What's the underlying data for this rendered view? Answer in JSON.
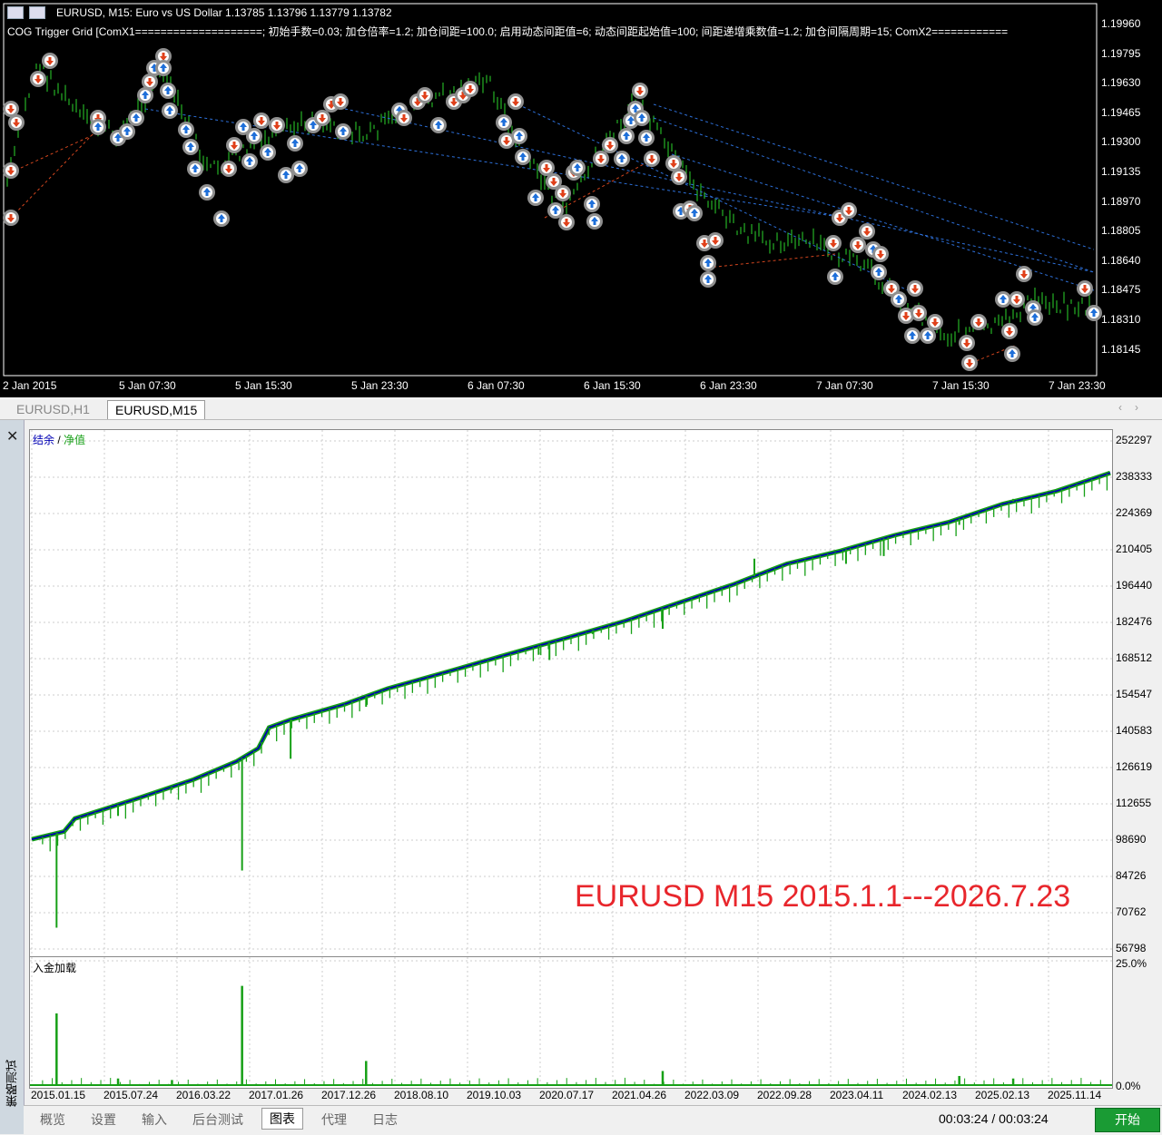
{
  "price_chart": {
    "title": "EURUSD, M15:  Euro vs US Dollar  1.13785 1.13796 1.13779 1.13782",
    "ea_line": "COG Trigger Grid [ComX1====================; 初始手数=0.03; 加仓倍率=1.2; 加仓间距=100.0; 启用动态间距值=6; 动态间距起始值=100; 间距递增乘数值=1.2; 加仓间隔周期=15; ComX2============",
    "y_labels": [
      "1.19960",
      "1.19795",
      "1.19630",
      "1.19465",
      "1.19300",
      "1.19135",
      "1.18970",
      "1.18805",
      "1.18640",
      "1.18475",
      "1.18310",
      "1.18145"
    ],
    "x_labels": [
      "2 Jan 2015",
      "5 Jan 07:30",
      "5 Jan 15:30",
      "5 Jan 23:30",
      "6 Jan 07:30",
      "6 Jan 15:30",
      "6 Jan 23:30",
      "7 Jan 07:30",
      "7 Jan 15:30",
      "7 Jan 23:30"
    ],
    "colors": {
      "background": "#000000",
      "candles": "#2bd62b",
      "buy_arrow": "#1e6fd9",
      "sell_arrow": "#e0401a",
      "marker_ring": "#8f8f8f"
    }
  },
  "chart_tabs": [
    {
      "label": "EURUSD,H1",
      "active": false
    },
    {
      "label": "EURUSD,M15",
      "active": true
    }
  ],
  "tester": {
    "side_label": "策略测试",
    "legend_balance": "结余",
    "legend_sep": " / ",
    "legend_equity": "净值",
    "deposit_title": "入金加载",
    "annotation": "EURUSD M15 2015.1.1---2026.7.23",
    "timer": "00:03:24 / 00:03:24",
    "start_label": "开始",
    "tabs": [
      {
        "label": "概览",
        "active": false
      },
      {
        "label": "设置",
        "active": false
      },
      {
        "label": "输入",
        "active": false
      },
      {
        "label": "后台测试",
        "active": false
      },
      {
        "label": "图表",
        "active": true
      },
      {
        "label": "代理",
        "active": false
      },
      {
        "label": "日志",
        "active": false
      }
    ]
  },
  "chart_data": [
    {
      "type": "line",
      "title": "",
      "legend": [
        "结余",
        "净值"
      ],
      "colors": {
        "balance": "#0000b4",
        "equity": "#16a016"
      },
      "ylim": [
        56798,
        252297
      ],
      "y_ticks": [
        "252297",
        "238333",
        "224369",
        "210405",
        "196440",
        "182476",
        "168512",
        "154547",
        "140583",
        "126619",
        "112655",
        "98690",
        "84726",
        "70762",
        "56798"
      ],
      "x_ticks": [
        "2015.01.15",
        "2015.07.24",
        "2016.03.22",
        "2017.01.26",
        "2017.12.26",
        "2018.08.10",
        "2019.10.03",
        "2020.07.17",
        "2021.04.26",
        "2022.03.09",
        "2022.09.28",
        "2023.04.11",
        "2024.02.13",
        "2025.02.13",
        "2025.11.14"
      ],
      "series": [
        {
          "name": "结余",
          "x": [
            0,
            3,
            4,
            10,
            15,
            19,
            21,
            22,
            24,
            29,
            33,
            39,
            44,
            50,
            55,
            60,
            65,
            70,
            75,
            80,
            85,
            90,
            95,
            100
          ],
          "values": [
            99000,
            102000,
            107000,
            115000,
            122000,
            129000,
            134000,
            142000,
            145000,
            151000,
            157000,
            164000,
            170000,
            177000,
            183000,
            190000,
            197000,
            205000,
            210000,
            216000,
            221000,
            228000,
            233000,
            240000
          ]
        },
        {
          "name": "净值 drawdowns",
          "x": [
            2.3,
            8,
            13,
            19.5,
            24,
            31,
            39,
            47,
            48,
            52,
            58.5,
            67,
            75.5,
            79,
            86,
            91
          ],
          "values": [
            65000,
            108000,
            118000,
            87000,
            130000,
            150000,
            164000,
            170000,
            168000,
            178000,
            180000,
            207000,
            205000,
            208000,
            220000,
            230000
          ]
        }
      ]
    },
    {
      "type": "bar",
      "title": "入金加载",
      "ylim": [
        0,
        25
      ],
      "y_ticks": [
        "25.0%",
        "0.0%"
      ],
      "values_percent": {
        "x": [
          2.3,
          8,
          13,
          19.5,
          31,
          58.5,
          86,
          91
        ],
        "load": [
          14.5,
          1.5,
          1.2,
          20,
          5,
          3,
          2,
          1.5
        ]
      }
    }
  ]
}
